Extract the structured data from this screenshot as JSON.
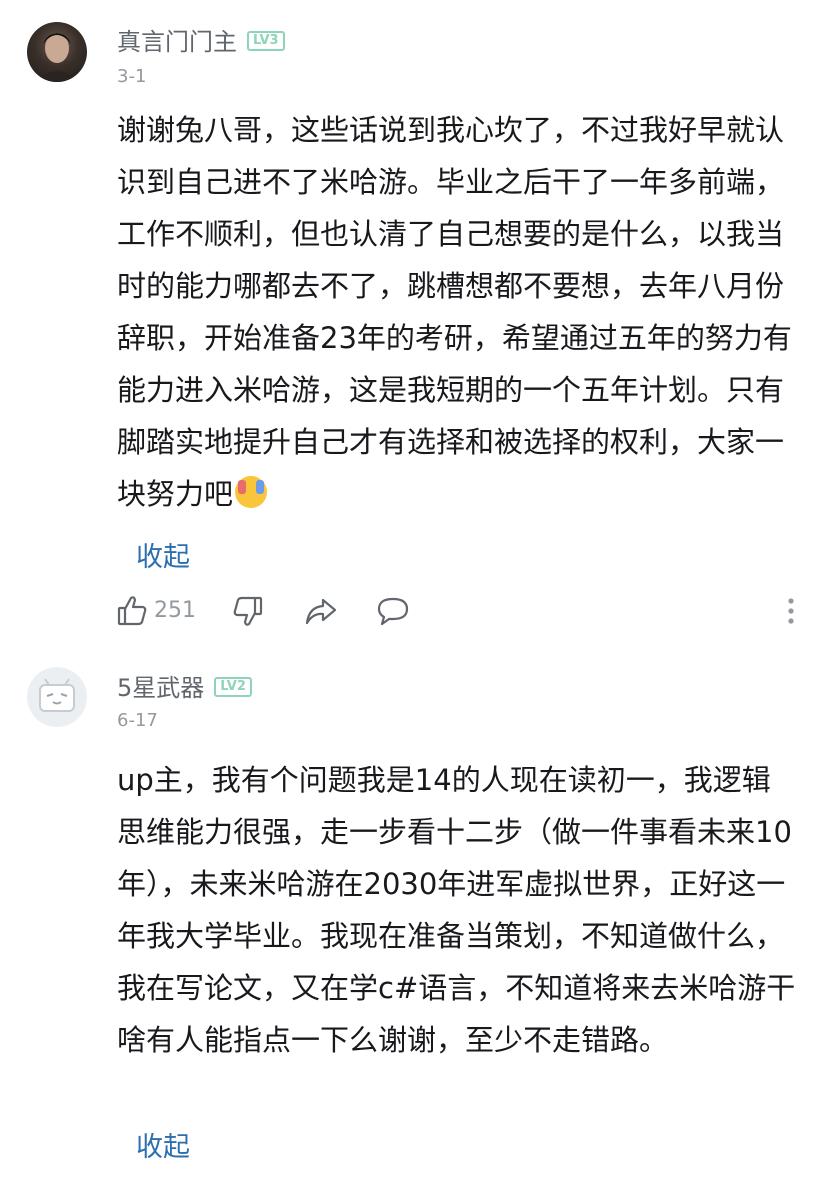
{
  "comments": [
    {
      "username": "真言门门主",
      "level": "LV3",
      "date": "3-1",
      "text": "谢谢兔八哥，这些话说到我心坎了，不过我好早就认识到自己进不了米哈游。毕业之后干了一年多前端，工作不顺利，但也认清了自己想要的是什么，以我当时的能力哪都去不了，跳槽想都不要想，去年八月份辞职，开始准备23年的考研，希望通过五年的努力有能力进入米哈游，这是我短期的一个五年计划。只有脚踏实地提升自己才有选择和被选择的权利，大家一块努力吧",
      "collapse_label": "收起",
      "like_count": "251",
      "icons": [
        "thumbs-up-icon",
        "thumbs-down-icon",
        "share-icon",
        "reply-icon",
        "more-icon"
      ]
    },
    {
      "username": "5星武器",
      "level": "LV2",
      "date": "6-17",
      "text": "up主，我有个问题我是14的人现在读初一，我逻辑思维能力很强，走一步看十二步（做一件事看未来10年），未来米哈游在2030年进军虚拟世界，正好这一年我大学毕业。我现在准备当策划，不知道做什么，我在写论文，又在学c#语言，不知道将来去米哈游干啥有人能指点一下么谢谢，至少不走错路。",
      "collapse_label": "收起"
    }
  ],
  "colors": {
    "level_badge": "#8ed4b8",
    "link": "#2b6fae",
    "meta": "#9499a0"
  }
}
